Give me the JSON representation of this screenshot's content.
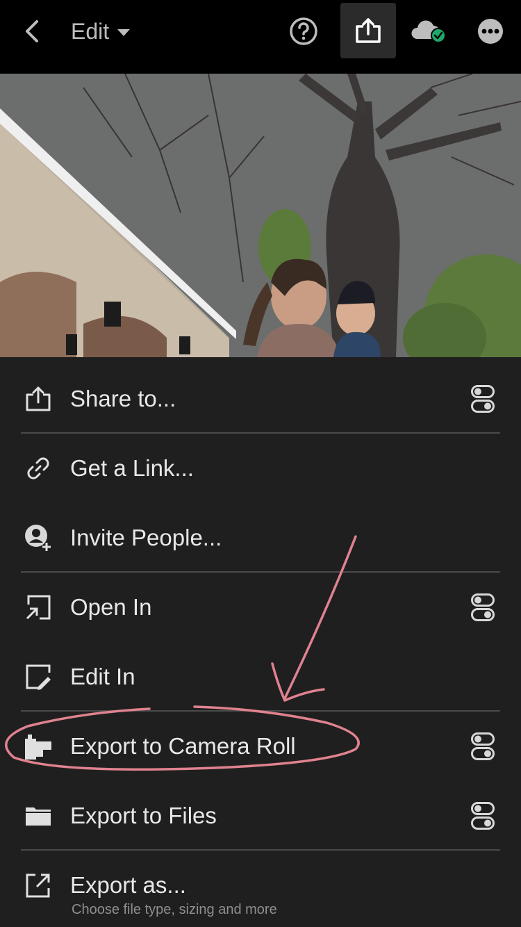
{
  "header": {
    "edit_label": "Edit",
    "icons": [
      "back-chevron",
      "help-circle",
      "share-upload",
      "cloud-synced",
      "more-dots"
    ],
    "accent_check_color": "#1fa86a"
  },
  "photo": {
    "subject": "photo of a woman kissing a baby in front of a tree and building"
  },
  "menu": {
    "items": [
      {
        "label": "Share to...",
        "icon": "share-icon",
        "has_toggle": true
      },
      {
        "label": "Get a Link...",
        "icon": "link-icon",
        "has_toggle": false
      },
      {
        "label": "Invite People...",
        "icon": "invite-person-icon",
        "has_toggle": false
      },
      {
        "label": "Open In",
        "icon": "open-in-icon",
        "has_toggle": true
      },
      {
        "label": "Edit In",
        "icon": "edit-in-icon",
        "has_toggle": false
      },
      {
        "label": "Export to Camera Roll",
        "icon": "camera-roll-icon",
        "has_toggle": true
      },
      {
        "label": "Export to Files",
        "icon": "folder-icon",
        "has_toggle": true
      },
      {
        "label": "Export as...",
        "icon": "export-as-icon",
        "has_toggle": false,
        "sublabel": "Choose file type, sizing and more"
      }
    ]
  },
  "annotation": {
    "color": "#e0828f",
    "highlighted_item": "Export to Camera Roll"
  }
}
